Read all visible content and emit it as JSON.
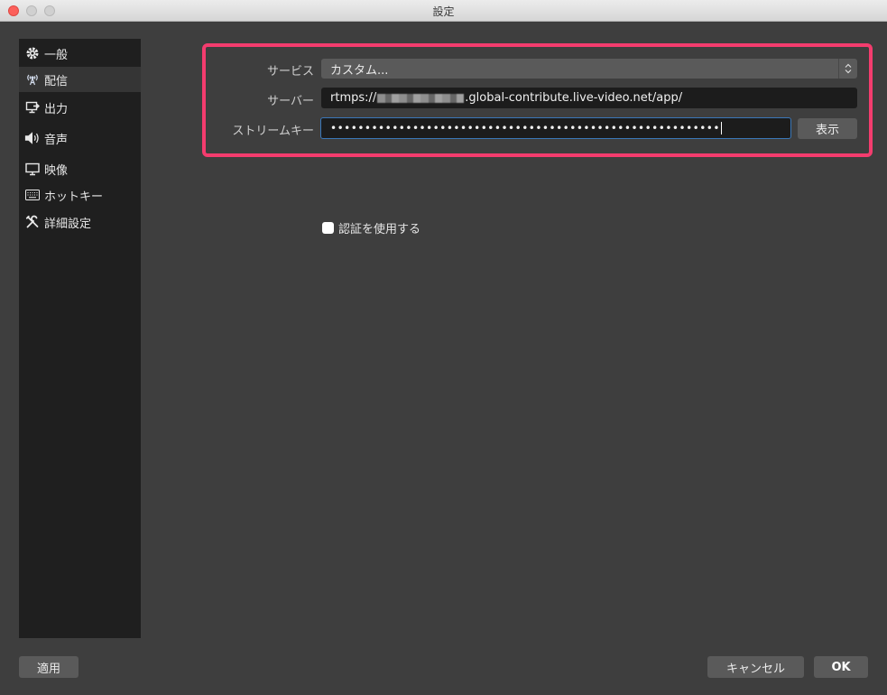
{
  "window": {
    "title": "設定"
  },
  "sidebar": {
    "items": [
      {
        "label": "一般",
        "icon": "gear-icon"
      },
      {
        "label": "配信",
        "icon": "broadcast-icon"
      },
      {
        "label": "出力",
        "icon": "output-icon"
      },
      {
        "label": "音声",
        "icon": "speaker-icon"
      },
      {
        "label": "映像",
        "icon": "monitor-icon"
      },
      {
        "label": "ホットキー",
        "icon": "keyboard-icon"
      },
      {
        "label": "詳細設定",
        "icon": "tools-icon"
      }
    ],
    "active_index": 1
  },
  "stream": {
    "service_label": "サービス",
    "service_value": "カスタム...",
    "server_label": "サーバー",
    "server_prefix": "rtmps://",
    "server_suffix": ".global-contribute.live-video.net/app/",
    "key_label": "ストリームキー",
    "key_value": "•••••••••••••••••••••••••••••••••••••••••••••••••••••••••",
    "show_button": "表示",
    "auth_checkbox_label": "認証を使用する",
    "auth_checked": false
  },
  "footer": {
    "apply": "適用",
    "cancel": "キャンセル",
    "ok": "OK"
  },
  "colors": {
    "highlight": "#f43c6e",
    "background": "#3e3e3e",
    "sidebar": "#1f1f1f",
    "focus": "#3a77b8"
  }
}
